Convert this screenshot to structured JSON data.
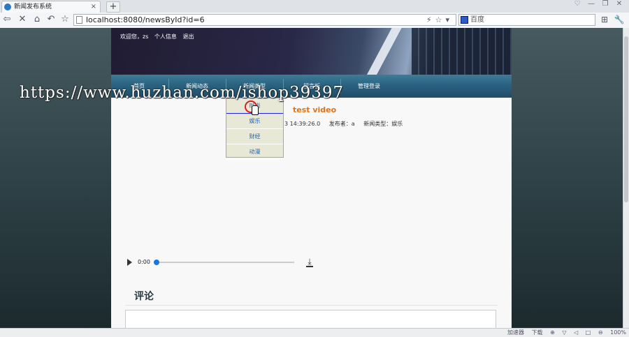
{
  "browser": {
    "tab_title": "新闻发布系统",
    "tab_close": "×",
    "new_tab": "+",
    "window_controls": [
      "♡",
      "—",
      "❐",
      "✕"
    ],
    "nav_buttons": [
      "⇦",
      "✕",
      "⌂",
      "↶",
      "☆"
    ],
    "address": "localhost:8080/newsById?id=6",
    "address_tools": "⚡☆▾",
    "search_placeholder": "百度",
    "tool_icons": [
      "⊞",
      "🔧"
    ]
  },
  "site": {
    "userbar": [
      "欢迎您，zs",
      "个人信息",
      "退出"
    ],
    "menu": [
      "首页",
      "新闻动态",
      "新闻类型",
      "留言板",
      "管理登录"
    ],
    "dropdown": [
      "时尚",
      "娱乐",
      "财经",
      "动漫"
    ]
  },
  "article": {
    "title": "test video",
    "meta": [
      "3 14:39:26.0",
      "发布者：a",
      "新闻类型：娱乐"
    ]
  },
  "player": {
    "time": "0:00",
    "progress": 0,
    "download_glyph": "⤓"
  },
  "comments": {
    "heading": "评论"
  },
  "watermark": "https://www.huzhan.com/ishop39397",
  "statusbar": [
    "加速器",
    "下载",
    "⊕",
    "▽",
    "◁",
    "□",
    "⊖",
    "100%"
  ]
}
